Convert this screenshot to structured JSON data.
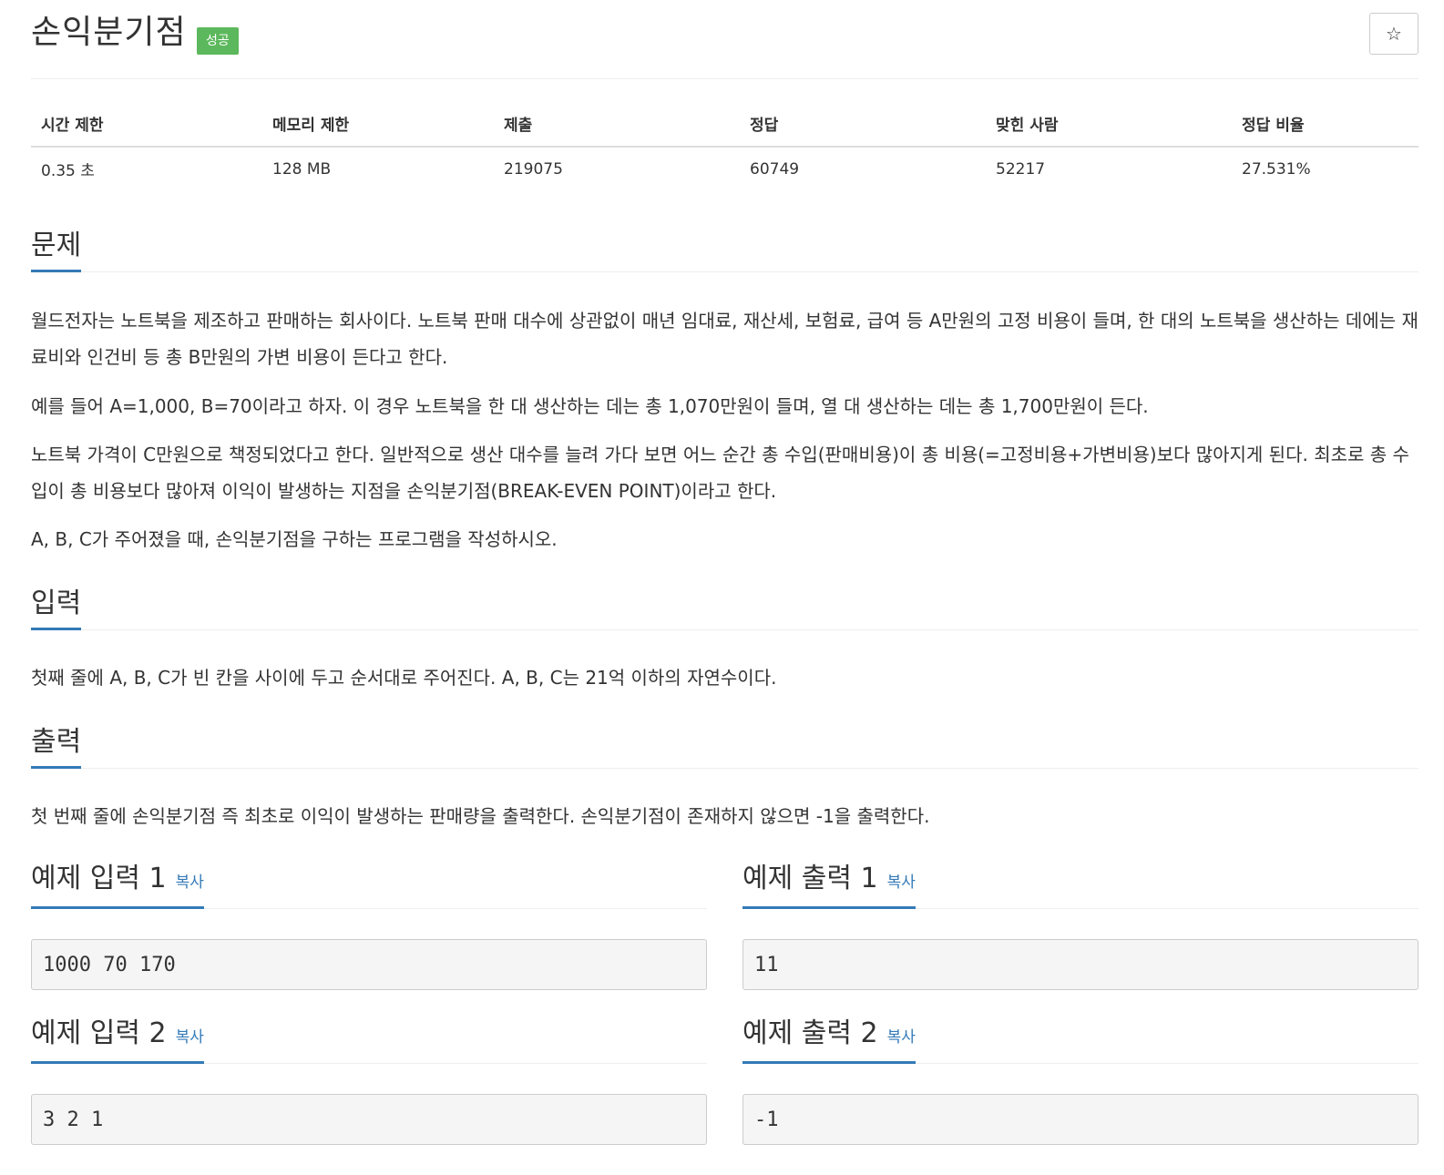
{
  "problem": {
    "title": "손익분기점",
    "badge": "성공",
    "star_icon": "☆"
  },
  "info_table": {
    "headers": [
      "시간 제한",
      "메모리 제한",
      "제출",
      "정답",
      "맞힌 사람",
      "정답 비율"
    ],
    "values": [
      "0.35 초",
      "128 MB",
      "219075",
      "60749",
      "52217",
      "27.531%"
    ]
  },
  "sections": {
    "description": {
      "title": "문제",
      "paragraphs": [
        "월드전자는 노트북을 제조하고 판매하는 회사이다. 노트북 판매 대수에 상관없이 매년 임대료, 재산세, 보험료, 급여 등 A만원의 고정 비용이 들며, 한 대의 노트북을 생산하는 데에는 재료비와 인건비 등 총 B만원의 가변 비용이 든다고 한다.",
        "예를 들어 A=1,000, B=70이라고 하자. 이 경우 노트북을 한 대 생산하는 데는 총 1,070만원이 들며, 열 대 생산하는 데는 총 1,700만원이 든다.",
        "노트북 가격이 C만원으로 책정되었다고 한다. 일반적으로 생산 대수를 늘려 가다 보면 어느 순간 총 수입(판매비용)이 총 비용(=고정비용+가변비용)보다 많아지게 된다. 최초로 총 수입이 총 비용보다 많아져 이익이 발생하는 지점을 손익분기점(BREAK-EVEN POINT)이라고 한다.",
        "A, B, C가 주어졌을 때, 손익분기점을 구하는 프로그램을 작성하시오."
      ]
    },
    "input": {
      "title": "입력",
      "text": "첫째 줄에 A, B, C가 빈 칸을 사이에 두고 순서대로 주어진다. A, B, C는 21억 이하의 자연수이다."
    },
    "output": {
      "title": "출력",
      "text": "첫 번째 줄에 손익분기점 즉 최초로 이익이 발생하는 판매량을 출력한다. 손익분기점이 존재하지 않으면 -1을 출력한다."
    }
  },
  "samples": {
    "copy_label": "복사",
    "input1_title": "예제 입력 1",
    "input1": "1000 70 170",
    "output1_title": "예제 출력 1",
    "output1": "11",
    "input2_title": "예제 입력 2",
    "input2": "3 2 1",
    "output2_title": "예제 출력 2",
    "output2": "-1"
  }
}
